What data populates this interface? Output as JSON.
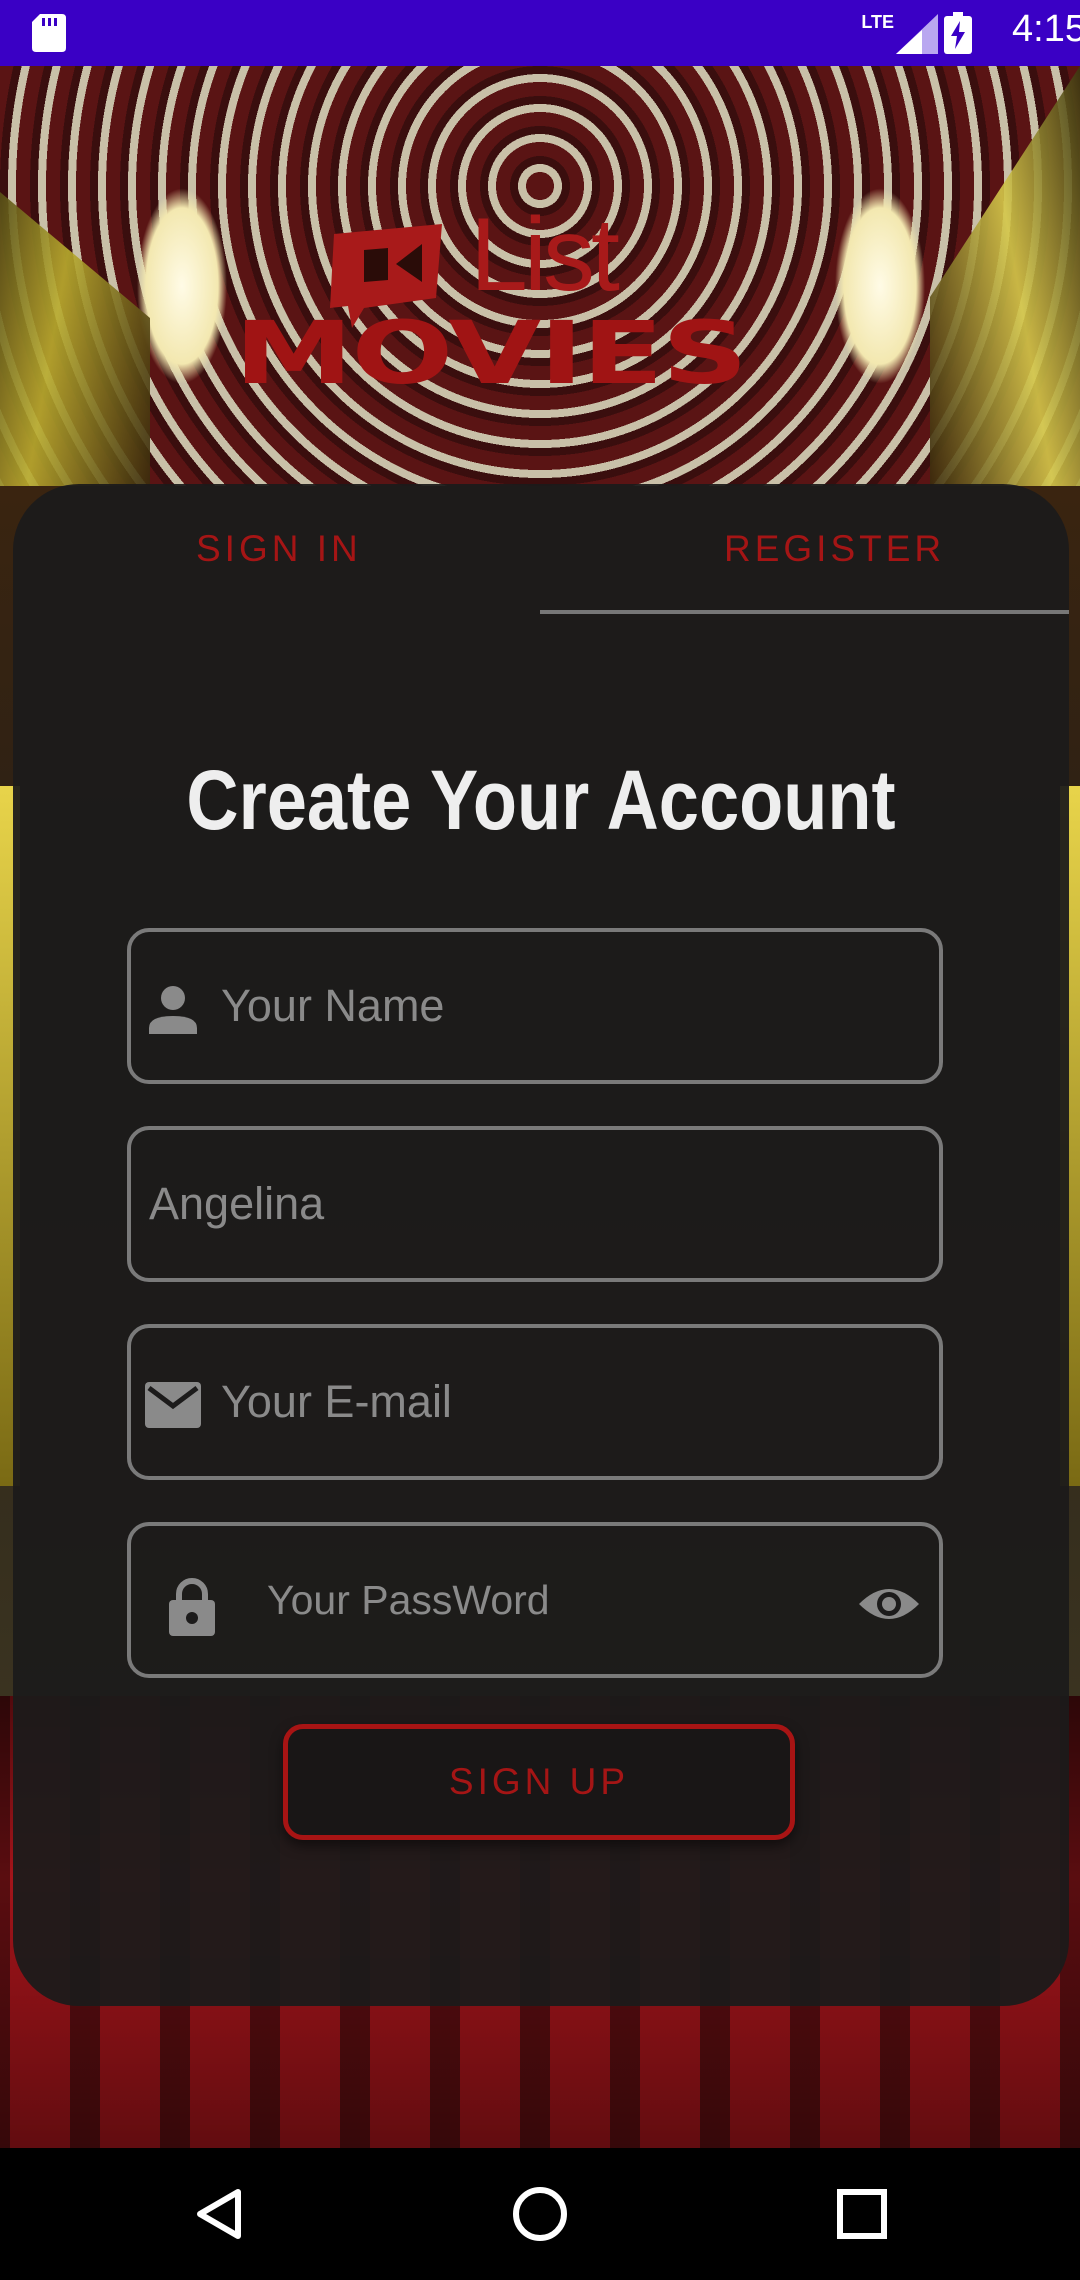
{
  "status_bar": {
    "network": "LTE",
    "time": "4:15"
  },
  "logo": {
    "word_top": "List",
    "word_bottom": "MOVIES"
  },
  "tabs": [
    {
      "label": "SIGN IN",
      "selected": false
    },
    {
      "label": "REGISTER",
      "selected": true
    }
  ],
  "form": {
    "heading": "Create Your Account",
    "name_placeholder": "Your Name",
    "last_name_value": "Angelina",
    "email_placeholder": "Your E-mail",
    "password_placeholder": "Your PassWord",
    "submit_label": "SIGN UP"
  },
  "colors": {
    "accent": "#a51515",
    "status_bar": "#3a00c5",
    "card": "#1c1b1b",
    "field_border": "#7a7a7a"
  },
  "icons": {
    "name_field": "person-icon",
    "email_field": "mail-icon",
    "password_field": "lock-icon",
    "password_toggle": "eye-icon",
    "nav": [
      "back-icon",
      "home-icon",
      "recents-icon"
    ]
  }
}
